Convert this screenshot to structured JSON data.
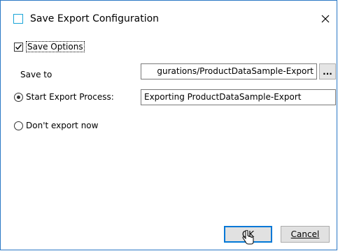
{
  "window": {
    "title": "Save Export Configuration",
    "close_icon": "close-icon",
    "app_icon": "window-icon"
  },
  "options": {
    "save_options_label": "Save Options",
    "save_options_checked": true
  },
  "save_to": {
    "label": "Save to",
    "value": "gurations/ProductDataSample-Export",
    "browse_label": "..."
  },
  "start_export": {
    "label": "Start Export Process:",
    "selected": true,
    "value": "Exporting ProductDataSample-Export"
  },
  "dont_export": {
    "label": "Don't export now",
    "selected": false
  },
  "buttons": {
    "ok_label": "OK",
    "cancel_label": "Cancel"
  },
  "colors": {
    "window_border": "#2b78c5",
    "focus_blue": "#0078d7"
  }
}
